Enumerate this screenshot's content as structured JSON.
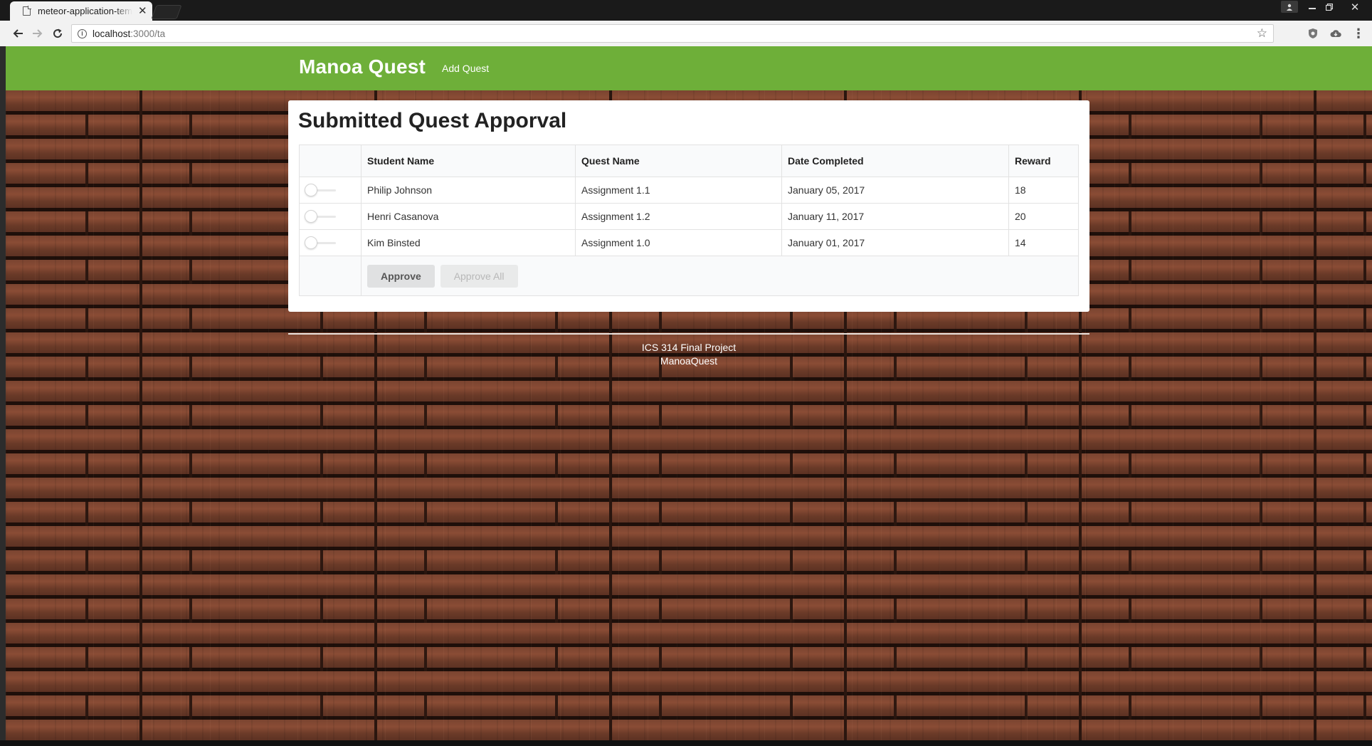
{
  "browser": {
    "tab_title": "meteor-application-template",
    "url_host": "localhost",
    "url_rest": ":3000/ta"
  },
  "navbar": {
    "brand": "Manoa Quest",
    "links": [
      "Add Quest"
    ],
    "color": "#6eaf39"
  },
  "page": {
    "title": "Submitted Quest Apporval",
    "table": {
      "headers": [
        "",
        "Student Name",
        "Quest Name",
        "Date Completed",
        "Reward"
      ],
      "rows": [
        {
          "student": "Philip Johnson",
          "quest": "Assignment 1.1",
          "date": "January 05, 2017",
          "reward": "18",
          "approved": false
        },
        {
          "student": "Henri Casanova",
          "quest": "Assignment 1.2",
          "date": "January 11, 2017",
          "reward": "20",
          "approved": false
        },
        {
          "student": "Kim Binsted",
          "quest": "Assignment 1.0",
          "date": "January 01, 2017",
          "reward": "14",
          "approved": false
        }
      ]
    },
    "buttons": {
      "approve": "Approve",
      "approve_all": "Approve All"
    }
  },
  "footer": {
    "line1": "ICS 314 Final Project",
    "line2": "ManoaQuest"
  }
}
